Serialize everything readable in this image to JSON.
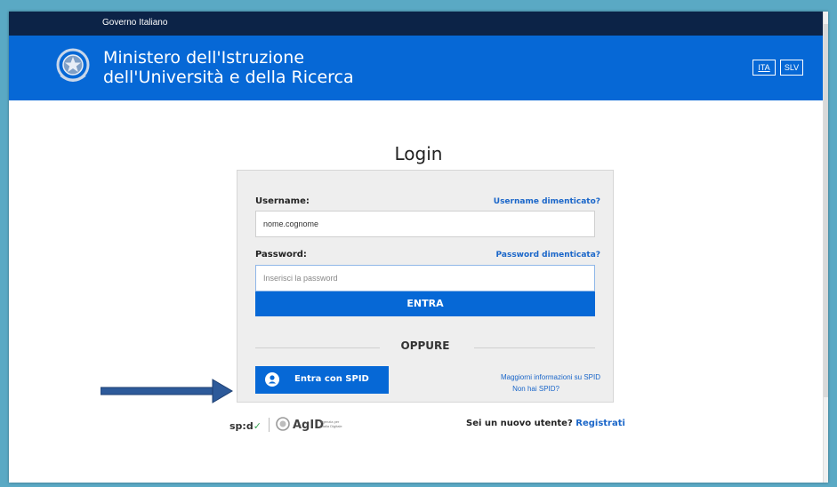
{
  "topbar": {
    "gov_label": "Governo Italiano"
  },
  "header": {
    "ministry_line1": "Ministero dell'Istruzione",
    "ministry_line2": "dell'Università e della Ricerca",
    "lang_ita": "ITA",
    "lang_slv": "SLV",
    "emblem_icon": "italian-republic-emblem-icon"
  },
  "login": {
    "title": "Login",
    "username_label": "Username:",
    "username_forgot": "Username dimenticato?",
    "username_value": "nome.cognome",
    "password_label": "Password:",
    "password_forgot": "Password dimenticata?",
    "password_placeholder": "Inserisci la password",
    "submit_label": "ENTRA",
    "or_label": "OPPURE",
    "spid_button_label": "Entra con SPID",
    "spid_more_info": "Maggiorni informazioni su SPID",
    "spid_no_spid": "Non hai SPID?"
  },
  "footer": {
    "spid_logo_text": "sp:d",
    "agid_logo_text": "AgID",
    "agid_sub_line1": "Agenzia per",
    "agid_sub_line2": "l'Italia Digitale",
    "new_user_text": "Sei un nuovo utente?",
    "register_link": "Registrati"
  },
  "colors": {
    "topbar": "#0c2347",
    "header": "#0668d6",
    "link": "#1a66c9",
    "arrow": "#2d5a9a"
  }
}
